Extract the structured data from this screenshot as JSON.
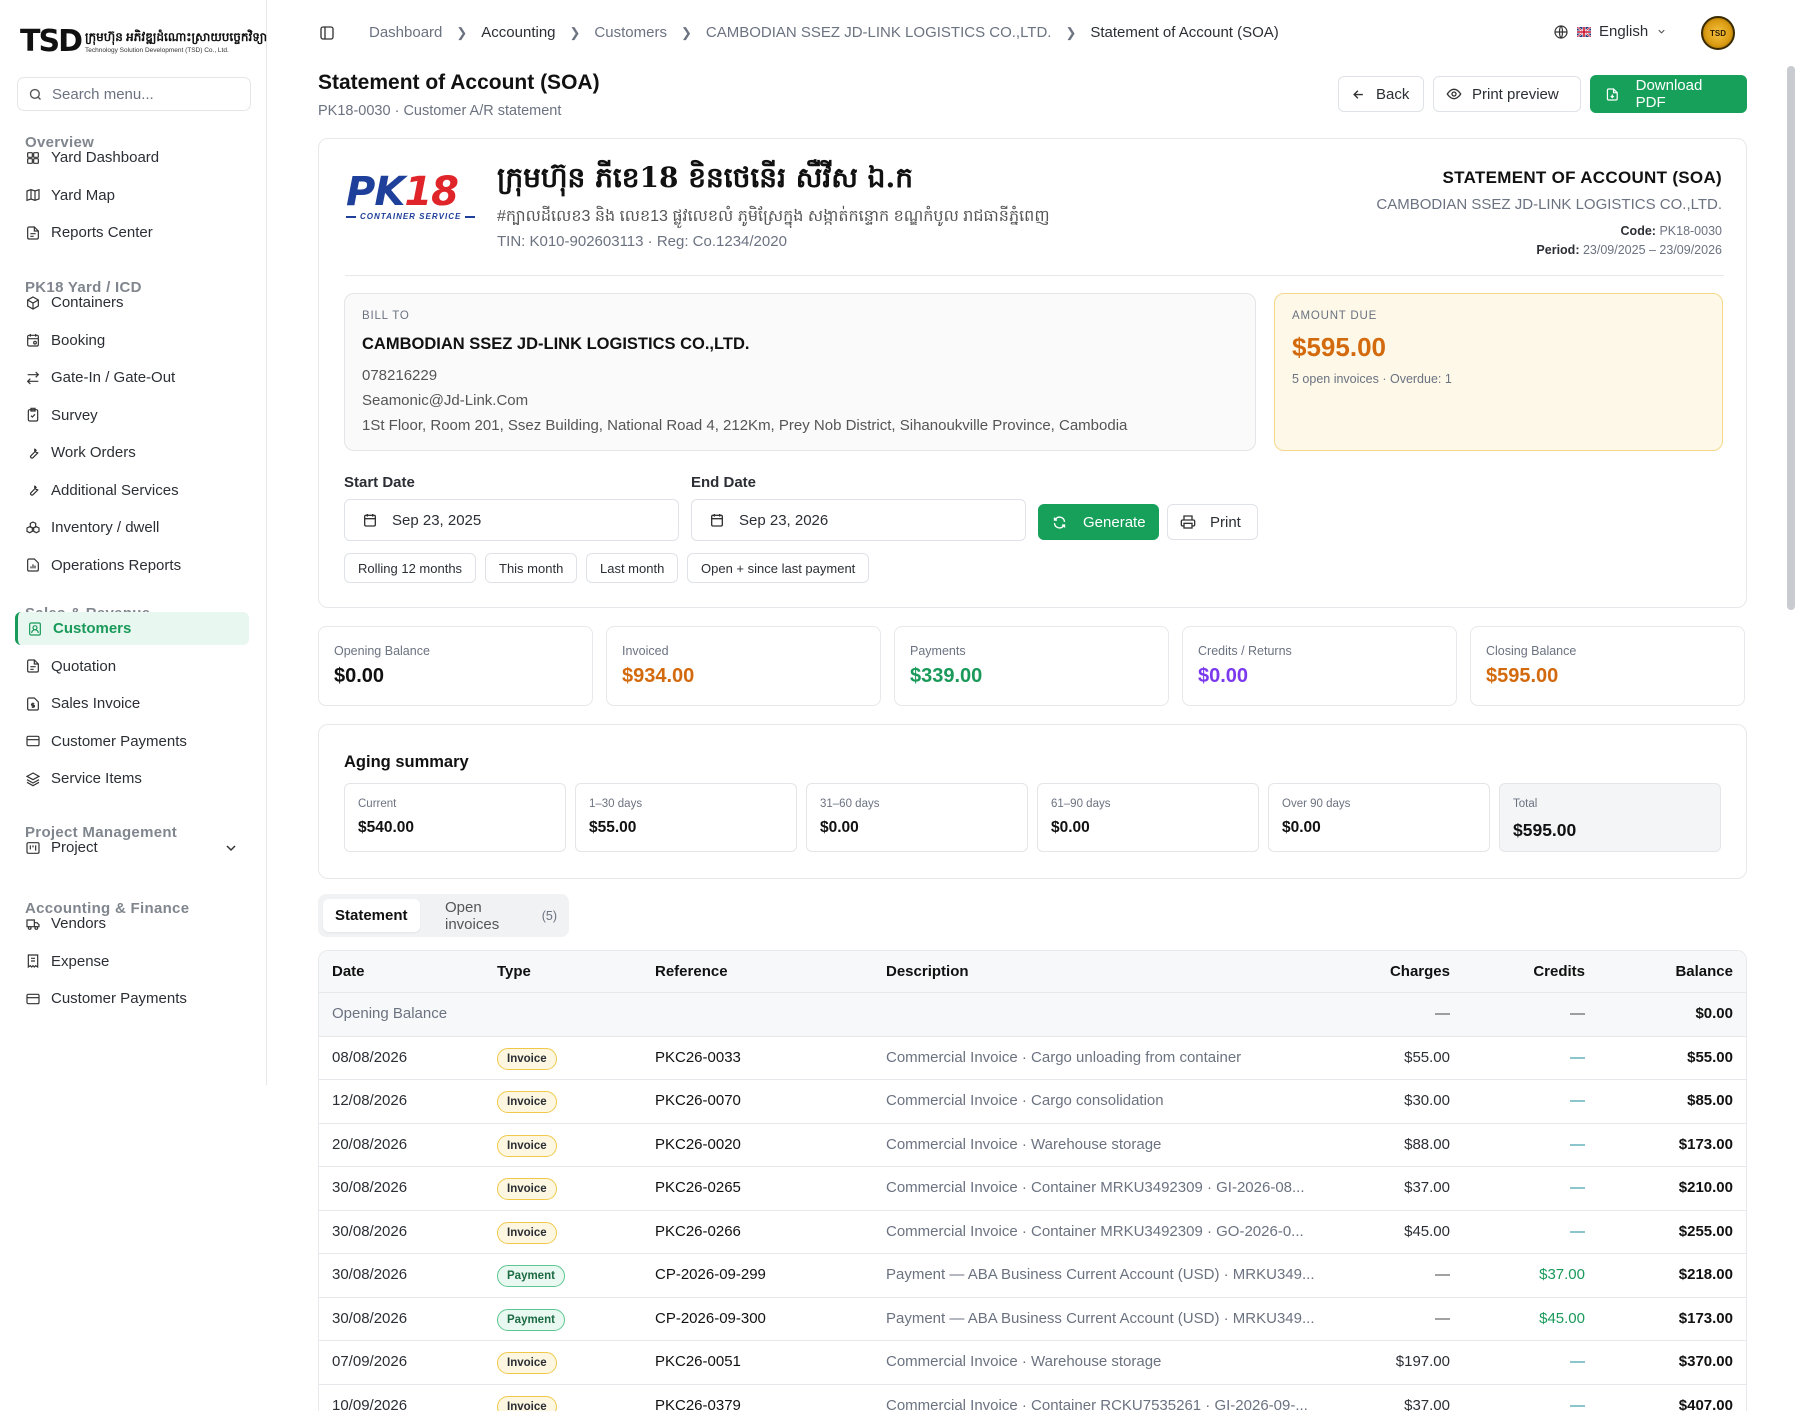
{
  "app": {
    "logo_mark": "TSD",
    "logo_line1": "ក្រុមហ៊ុន អភិវឌ្ឍដំណោះស្រាយបច្ចេកវិទ្យា",
    "logo_line2": "Technology Solution Development (TSD) Co., Ltd."
  },
  "sidebar": {
    "search_placeholder": "Search menu...",
    "sections": [
      {
        "label": "Overview",
        "items": [
          {
            "label": "Yard Dashboard",
            "icon": "grid-icon"
          },
          {
            "label": "Yard Map",
            "icon": "map-icon"
          },
          {
            "label": "Reports Center",
            "icon": "file-icon"
          }
        ]
      },
      {
        "label": "PK18 Yard / ICD",
        "items": [
          {
            "label": "Containers",
            "icon": "box-icon"
          },
          {
            "label": "Booking",
            "icon": "calendar-icon"
          },
          {
            "label": "Gate-In / Gate-Out",
            "icon": "swap-icon"
          },
          {
            "label": "Survey",
            "icon": "clipboard-icon"
          },
          {
            "label": "Work Orders",
            "icon": "wrench-icon"
          },
          {
            "label": "Additional Services",
            "icon": "wrench-icon"
          },
          {
            "label": "Inventory / dwell",
            "icon": "boxes-icon"
          },
          {
            "label": "Operations Reports",
            "icon": "report-icon"
          }
        ]
      },
      {
        "label": "Sales & Revenue",
        "items": [
          {
            "label": "Customers",
            "icon": "contact-icon",
            "active": true
          },
          {
            "label": "Quotation",
            "icon": "file-icon"
          },
          {
            "label": "Sales Invoice",
            "icon": "dollar-file-icon"
          },
          {
            "label": "Customer Payments",
            "icon": "card-icon"
          },
          {
            "label": "Service Items",
            "icon": "layers-icon"
          }
        ]
      },
      {
        "label": "Project Management",
        "items": [
          {
            "label": "Project",
            "icon": "kanban-icon"
          }
        ]
      },
      {
        "label": "Accounting & Finance",
        "items": [
          {
            "label": "Vendors",
            "icon": "truck-icon"
          },
          {
            "label": "Expense",
            "icon": "receipt-icon"
          },
          {
            "label": "Customer Payments",
            "icon": "card-icon"
          }
        ]
      }
    ]
  },
  "breadcrumb": [
    "Dashboard",
    "Accounting",
    "Customers",
    "CAMBODIAN SSEZ JD-LINK LOGISTICS CO.,LTD.",
    "Statement of Account (SOA)"
  ],
  "language": "English",
  "avatar_text": "TSD",
  "header": {
    "title": "Statement of Account (SOA)",
    "subtitle": "PK18-0030 · Customer A/R statement",
    "back": "Back",
    "print_preview": "Print preview",
    "download": "Download PDF"
  },
  "company": {
    "logo_pk": "PK",
    "logo_num": "18",
    "logo_sub": "CONTAINER SERVICE",
    "name": "ក្រុមហ៊ុន ភីខេ18 ខិនថេនើរ សឺវីស ឯ.ក",
    "address": "#ក្បាលដីលេខ3 និង លេខ13 ផ្លូវលេខលំ ភូមិស្រែក្នុង សង្កាត់កន្ទោក ខណ្ឌកំបូល រាជធានីភ្នំពេញ",
    "tin": "TIN: K010-902603113 · Reg: Co.1234/2020"
  },
  "soa": {
    "title": "STATEMENT OF ACCOUNT (SOA)",
    "customer": "CAMBODIAN SSEZ JD-LINK LOGISTICS CO.,LTD.",
    "code_label": "Code:",
    "code": "PK18-0030",
    "period_label": "Period:",
    "period": "23/09/2025 – 23/09/2026"
  },
  "bill_to": {
    "label": "BILL TO",
    "name": "CAMBODIAN SSEZ JD-LINK LOGISTICS CO.,LTD.",
    "phone": "078216229",
    "email": "Seamonic@Jd-Link.Com",
    "address": "1St Floor, Room 201, Ssez Building, National Road 4, 212Km, Prey Nob District, Sihanoukville Province, Cambodia"
  },
  "amount_due": {
    "label": "AMOUNT DUE",
    "value": "$595.00",
    "note": "5 open invoices · Overdue: 1"
  },
  "filters": {
    "start_label": "Start Date",
    "start_value": "Sep 23, 2025",
    "end_label": "End Date",
    "end_value": "Sep 23, 2026",
    "generate": "Generate",
    "print": "Print",
    "presets": [
      "Rolling 12 months",
      "This month",
      "Last month",
      "Open + since last payment"
    ]
  },
  "summary": [
    {
      "label": "Opening Balance",
      "value": "$0.00",
      "color": "#111111"
    },
    {
      "label": "Invoiced",
      "value": "$934.00",
      "color": "#d36a0e"
    },
    {
      "label": "Payments",
      "value": "$339.00",
      "color": "#1a9a5a"
    },
    {
      "label": "Credits / Returns",
      "value": "$0.00",
      "color": "#7c3aed"
    },
    {
      "label": "Closing Balance",
      "value": "$595.00",
      "color": "#d36a0e"
    }
  ],
  "aging": {
    "title": "Aging summary",
    "buckets": [
      {
        "label": "Current",
        "value": "$540.00"
      },
      {
        "label": "1–30 days",
        "value": "$55.00"
      },
      {
        "label": "31–60 days",
        "value": "$0.00"
      },
      {
        "label": "61–90 days",
        "value": "$0.00"
      },
      {
        "label": "Over 90 days",
        "value": "$0.00"
      },
      {
        "label": "Total",
        "value": "$595.00"
      }
    ]
  },
  "tabs": {
    "statement": "Statement",
    "open": "Open invoices",
    "open_count": "(5)"
  },
  "table": {
    "columns": [
      "Date",
      "Type",
      "Reference",
      "Description",
      "Charges",
      "Credits",
      "Balance"
    ],
    "opening": {
      "label": "Opening Balance",
      "charges": "—",
      "credits": "—",
      "balance": "$0.00"
    },
    "rows": [
      {
        "date": "08/08/2026",
        "type": "Invoice",
        "ref": "PKC26-0033",
        "desc": "Commercial Invoice · Cargo unloading from container",
        "charges": "$55.00",
        "credits": "—",
        "balance": "$55.00"
      },
      {
        "date": "12/08/2026",
        "type": "Invoice",
        "ref": "PKC26-0070",
        "desc": "Commercial Invoice · Cargo consolidation",
        "charges": "$30.00",
        "credits": "—",
        "balance": "$85.00"
      },
      {
        "date": "20/08/2026",
        "type": "Invoice",
        "ref": "PKC26-0020",
        "desc": "Commercial Invoice · Warehouse storage",
        "charges": "$88.00",
        "credits": "—",
        "balance": "$173.00"
      },
      {
        "date": "30/08/2026",
        "type": "Invoice",
        "ref": "PKC26-0265",
        "desc": "Commercial Invoice · Container MRKU3492309 · GI-2026-08...",
        "charges": "$37.00",
        "credits": "—",
        "balance": "$210.00"
      },
      {
        "date": "30/08/2026",
        "type": "Invoice",
        "ref": "PKC26-0266",
        "desc": "Commercial Invoice · Container MRKU3492309 · GO-2026-0...",
        "charges": "$45.00",
        "credits": "—",
        "balance": "$255.00"
      },
      {
        "date": "30/08/2026",
        "type": "Payment",
        "ref": "CP-2026-09-299",
        "desc": "Payment — ABA Business Current Account (USD) · MRKU349...",
        "charges": "—",
        "credits": "$37.00",
        "balance": "$218.00"
      },
      {
        "date": "30/08/2026",
        "type": "Payment",
        "ref": "CP-2026-09-300",
        "desc": "Payment — ABA Business Current Account (USD) · MRKU349...",
        "charges": "—",
        "credits": "$45.00",
        "balance": "$173.00"
      },
      {
        "date": "07/09/2026",
        "type": "Invoice",
        "ref": "PKC26-0051",
        "desc": "Commercial Invoice · Warehouse storage",
        "charges": "$197.00",
        "credits": "—",
        "balance": "$370.00"
      },
      {
        "date": "10/09/2026",
        "type": "Invoice",
        "ref": "PKC26-0379",
        "desc": "Commercial Invoice · Container RCKU7535261 · GI-2026-09-...",
        "charges": "$37.00",
        "credits": "—",
        "balance": "$407.00"
      }
    ]
  }
}
